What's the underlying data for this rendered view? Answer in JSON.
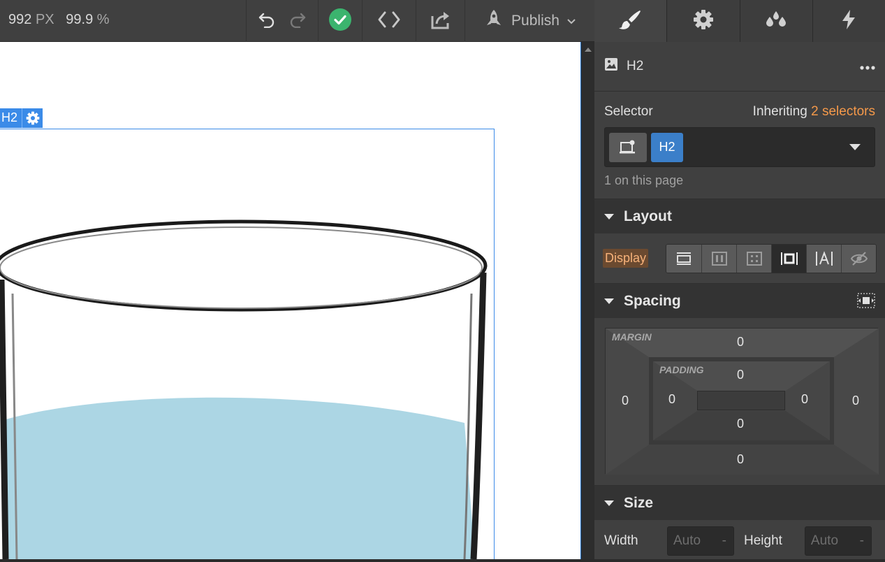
{
  "topbar": {
    "width_value": "992",
    "width_unit": "PX",
    "zoom_value": "99.9",
    "zoom_unit": "%",
    "publish_label": "Publish"
  },
  "canvas": {
    "selected_tag": "H2",
    "glass_water_color": "#acd6e4"
  },
  "panel": {
    "element_type": "H2",
    "selector_label": "Selector",
    "inheriting_prefix": "Inheriting",
    "inheriting_count": "2 selectors",
    "selector_chip": "H2",
    "on_page": "1 on this page",
    "layout_title": "Layout",
    "display_label": "Display",
    "spacing_title": "Spacing",
    "margin_label": "MARGIN",
    "padding_label": "PADDING",
    "margin": {
      "top": "0",
      "right": "0",
      "bottom": "0",
      "left": "0"
    },
    "padding": {
      "top": "0",
      "right": "0",
      "bottom": "0",
      "left": "0"
    },
    "size_title": "Size",
    "width_label": "Width",
    "width_value": "Auto",
    "width_unit": "-",
    "height_label": "Height",
    "height_value": "Auto",
    "height_unit": "-"
  },
  "colors": {
    "accent_blue": "#3b8be8",
    "success_green": "#3bb46e",
    "inherit_orange": "#f5994a"
  }
}
